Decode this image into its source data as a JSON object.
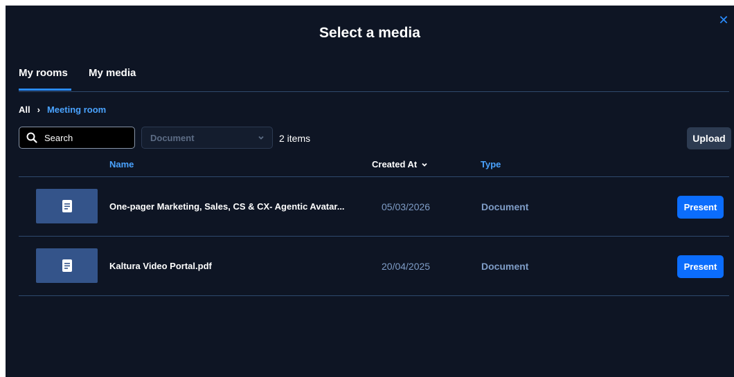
{
  "modal": {
    "title": "Select a media",
    "close_icon": "close-icon",
    "accent_color": "#2a8cff",
    "background_color": "#0e1524"
  },
  "tabs": [
    {
      "label": "My rooms",
      "active": true
    },
    {
      "label": "My media",
      "active": false
    }
  ],
  "breadcrumb": {
    "root": "All",
    "separator": "›",
    "current": "Meeting room"
  },
  "toolbar": {
    "search_placeholder": "Search",
    "search_icon": "search-icon",
    "filter_value": "Document",
    "filter_icon": "chevron-down-icon",
    "items_count": "2 items",
    "upload_label": "Upload"
  },
  "table": {
    "columns": {
      "name": "Name",
      "created_at": "Created At",
      "type": "Type"
    },
    "sort_icon": "chevron-down-icon",
    "rows": [
      {
        "name": "One-pager Marketing, Sales, CS & CX- Agentic Avatar...",
        "created_at": "05/03/2026",
        "type": "Document",
        "action": "Present",
        "thumb_icon": "document-icon"
      },
      {
        "name": "Kaltura Video Portal.pdf",
        "created_at": "20/04/2025",
        "type": "Document",
        "action": "Present",
        "thumb_icon": "document-icon"
      }
    ]
  }
}
